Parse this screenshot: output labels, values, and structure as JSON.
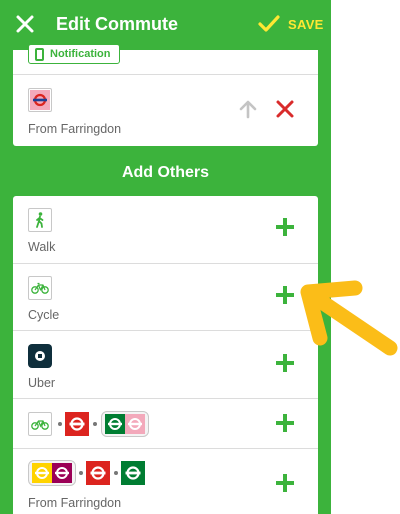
{
  "header": {
    "title": "Edit Commute",
    "save_label": "SAVE"
  },
  "current_commute": {
    "notification_label": "Notification",
    "leg": {
      "from_label": "From Farringdon"
    }
  },
  "add_others": {
    "title": "Add Others",
    "options": [
      {
        "label": "Walk"
      },
      {
        "label": "Cycle"
      },
      {
        "label": "Uber"
      },
      {
        "label": ""
      },
      {
        "label": "From Farringdon"
      }
    ]
  },
  "colors": {
    "brand_green": "#3cb33c",
    "save_yellow": "#ffe733",
    "remove_red": "#d92b2b",
    "annotation_arrow": "#fbbd18"
  },
  "icons": {
    "close": "close-icon",
    "save": "check-icon",
    "up": "up-arrow-icon",
    "remove": "remove-x-icon",
    "walk": "walk-icon",
    "cycle": "bicycle-icon",
    "uber": "uber-icon",
    "underground": "tfl-roundel-icon",
    "add": "plus-icon"
  }
}
